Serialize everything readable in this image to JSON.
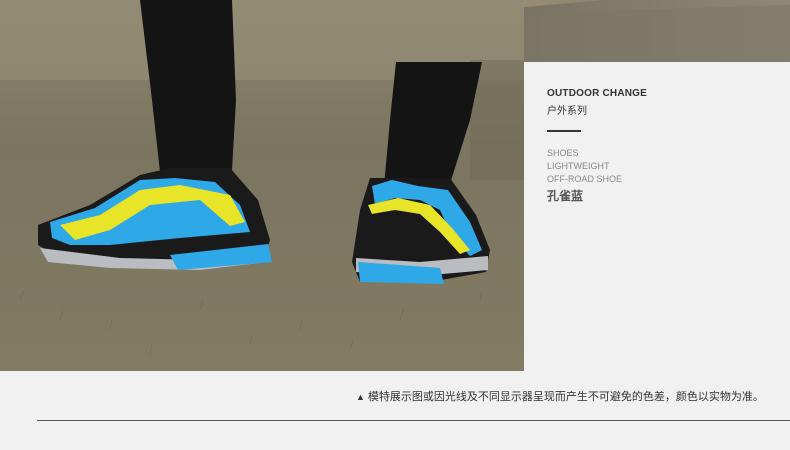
{
  "product": {
    "title_en": "OUTDOOR CHANGE",
    "title_cn": "户外系列",
    "specs": [
      "SHOES",
      "LIGHTWEIGHT",
      "OFF-ROAD SHOE"
    ],
    "color_name": "孔雀蓝"
  },
  "note": {
    "marker": "▲",
    "text": "模特展示图或因光线及不同显示器呈现而产生不可避免的色差，颜色以实物为准。"
  },
  "colors": {
    "background": "#f1f1f1",
    "shoe_yellow": "#e8e428",
    "shoe_blue": "#2ea8e6",
    "shoe_black": "#1a1a1a",
    "accent_green": "#7fd12a"
  }
}
